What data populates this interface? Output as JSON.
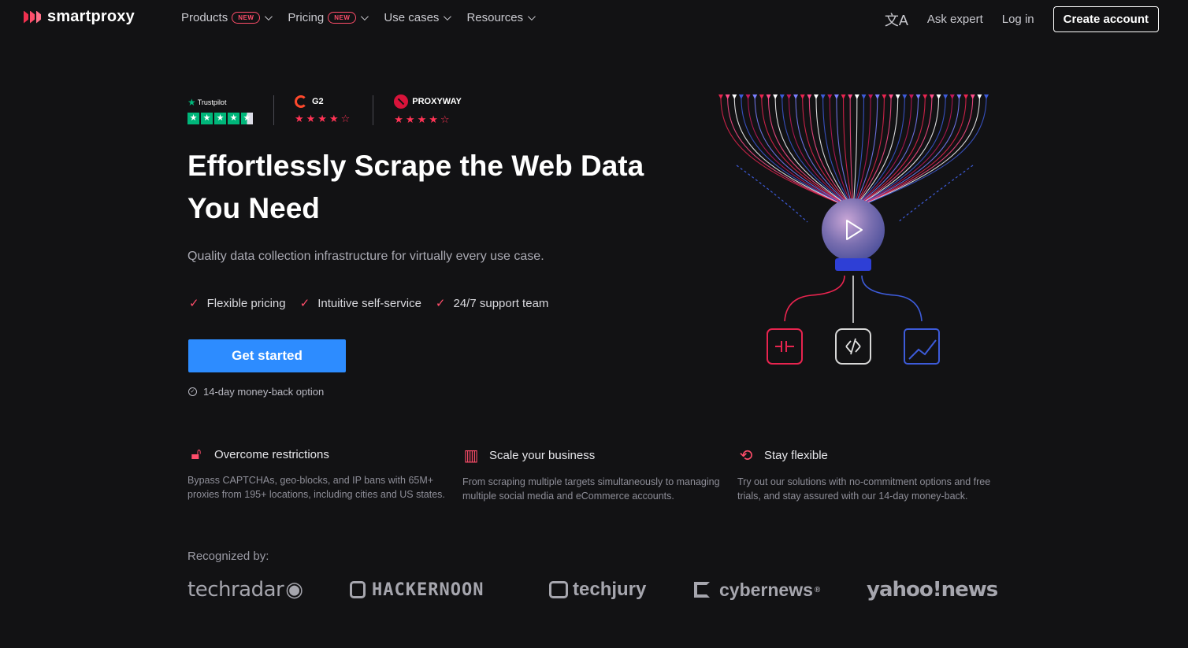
{
  "nav": {
    "logo_text": "smartproxy",
    "menu": [
      {
        "label": "Products",
        "badge": "NEW"
      },
      {
        "label": "Pricing",
        "badge": "NEW"
      },
      {
        "label": "Use cases",
        "badge": ""
      },
      {
        "label": "Resources",
        "badge": ""
      }
    ],
    "lang_icon": "文A",
    "ask_expert": "Ask expert",
    "login": "Log in",
    "create_account": "Create account"
  },
  "ratings": {
    "trustpilot": {
      "name": "Trustpilot",
      "stars": 4.5
    },
    "g2": {
      "name": "G2",
      "stars": 4.5
    },
    "proxyway": {
      "name": "PROXYWAY",
      "stars": 4.5
    }
  },
  "hero": {
    "title": "Effortlessly Scrape the Web Data You Need",
    "subtitle": "Quality data collection infrastructure for virtually every use case.",
    "checks": [
      "Flexible pricing",
      "Intuitive self-service",
      "24/7 support team"
    ],
    "cta": "Get started",
    "moneyback": "14-day money-back option"
  },
  "features": [
    {
      "icon": "unlock-icon",
      "title": "Overcome restrictions",
      "desc": "Bypass CAPTCHAs, geo-blocks, and IP bans with 65M+ proxies from 195+ locations, including cities and US states."
    },
    {
      "icon": "chart-icon",
      "title": "Scale your business",
      "desc": "From scraping multiple targets simultaneously to managing multiple social media and eCommerce accounts."
    },
    {
      "icon": "clock-refresh-icon",
      "title": "Stay flexible",
      "desc": "Try out our solutions with no-commitment options and free trials, and stay assured with our 14-day money-back."
    }
  ],
  "recognized": {
    "label": "Recognized by:",
    "brands": [
      "techradar",
      "HACKERNOON",
      "techjury",
      "cybernews",
      "yahoo!news"
    ]
  },
  "colors": {
    "accent_red": "#ff4d6a",
    "cta_blue": "#2d8cff",
    "background": "#121214",
    "trustpilot_green": "#00b67a"
  }
}
